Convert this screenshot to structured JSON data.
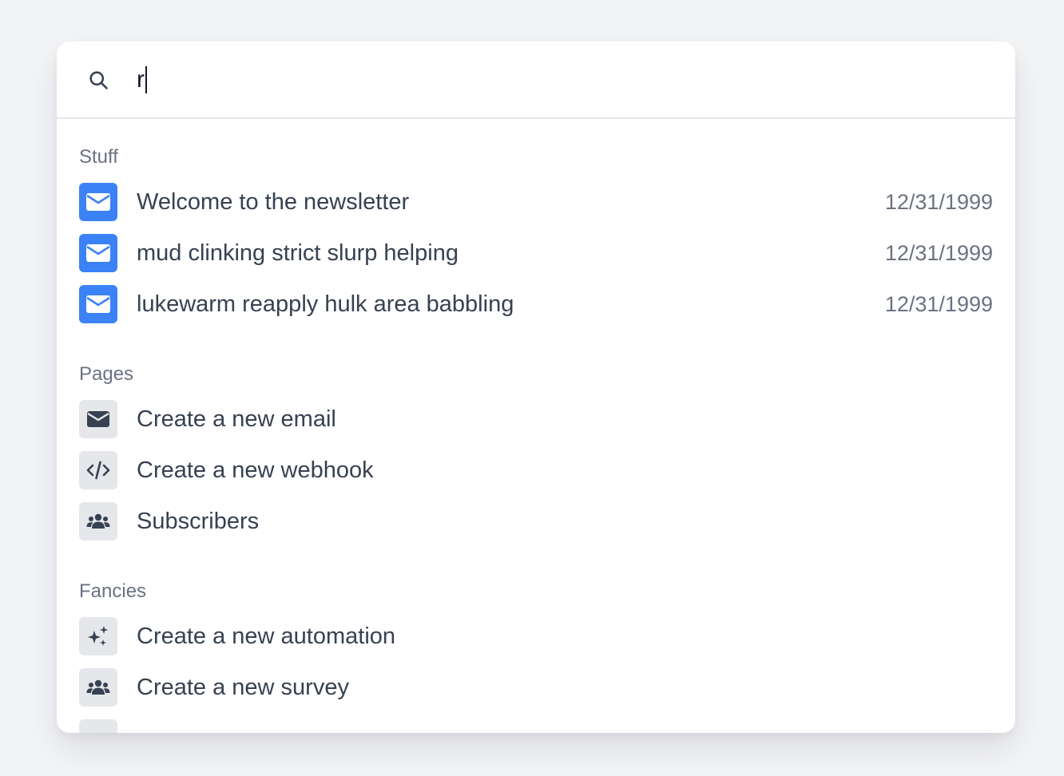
{
  "search": {
    "value": "r",
    "icon": "search-icon"
  },
  "groups": [
    {
      "title": "Stuff",
      "items": [
        {
          "label": "Welcome to the newsletter",
          "date": "12/31/1999",
          "icon": "mail-icon"
        },
        {
          "label": "mud clinking strict slurp helping",
          "date": "12/31/1999",
          "icon": "mail-icon"
        },
        {
          "label": "lukewarm reapply hulk area babbling",
          "date": "12/31/1999",
          "icon": "mail-icon"
        }
      ]
    },
    {
      "title": "Pages",
      "items": [
        {
          "label": "Create a new email",
          "icon": "mail-icon"
        },
        {
          "label": "Create a new webhook",
          "icon": "code-icon"
        },
        {
          "label": "Subscribers",
          "icon": "users-icon"
        }
      ]
    },
    {
      "title": "Fancies",
      "items": [
        {
          "label": "Create a new automation",
          "icon": "sparkles-icon"
        },
        {
          "label": "Create a new survey",
          "icon": "users-icon"
        }
      ]
    }
  ],
  "colors": {
    "accent": "#3b82f6",
    "icon_dark": "#374151",
    "icon_bg": "#e5e7eb"
  }
}
